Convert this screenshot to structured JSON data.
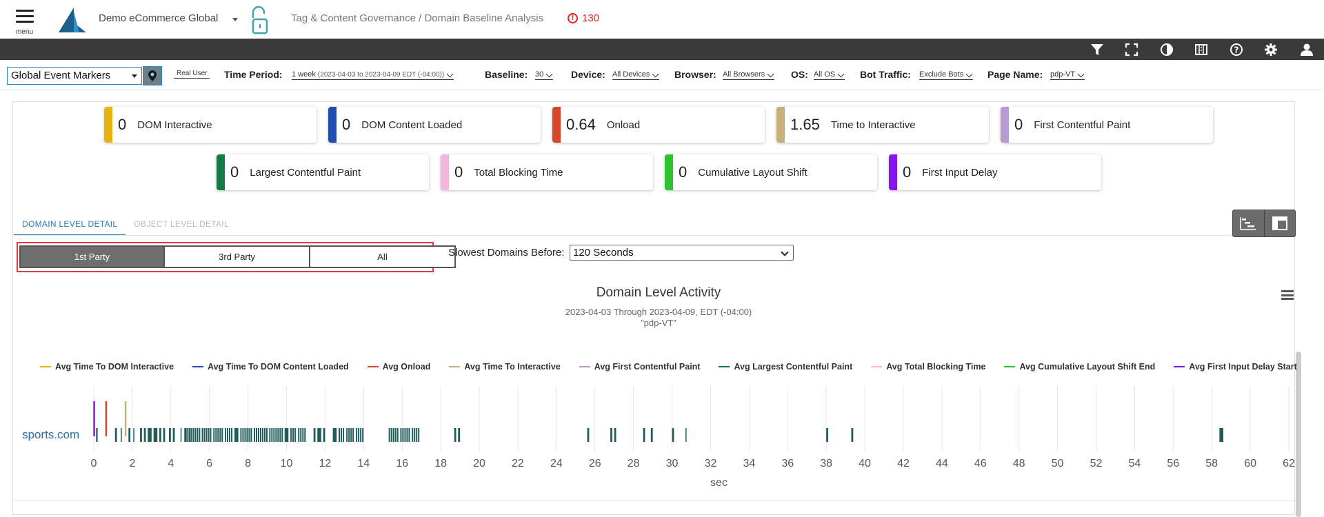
{
  "header": {
    "menu_label": "menu",
    "app_title": "Demo eCommerce Global",
    "breadcrumb": "Tag & Content Governance / Domain Baseline Analysis",
    "alert_count": "130"
  },
  "toolbar_icons": [
    "filter-icon",
    "fullscreen-icon",
    "contrast-icon",
    "columns-icon",
    "help-icon",
    "gear-icon",
    "user-icon"
  ],
  "filters": {
    "event_markers": "Global Event Markers",
    "rum_mode": "Real User",
    "time_period_label": "Time Period:",
    "time_period_value": "1 week",
    "time_period_range": "(2023-04-03 to 2023-04-09 EDT (-04:00))",
    "baseline_label": "Baseline:",
    "baseline_value": "30",
    "device_label": "Device:",
    "device_value": "All Devices",
    "browser_label": "Browser:",
    "browser_value": "All Browsers",
    "os_label": "OS:",
    "os_value": "All OS",
    "bot_label": "Bot Traffic:",
    "bot_value": "Exclude Bots",
    "page_label": "Page Name:",
    "page_value": "pdp-VT"
  },
  "metrics": [
    {
      "value": "0",
      "name": "DOM Interactive",
      "color": "#e8b40a"
    },
    {
      "value": "0",
      "name": "DOM Content Loaded",
      "color": "#1f4fb0"
    },
    {
      "value": "0.64",
      "name": "Onload",
      "color": "#d9442b"
    },
    {
      "value": "1.65",
      "name": "Time to Interactive",
      "color": "#c8b07a"
    },
    {
      "value": "0",
      "name": "First Contentful Paint",
      "color": "#b89bd0"
    },
    {
      "value": "0",
      "name": "Largest Contentful Paint",
      "color": "#137a4a"
    },
    {
      "value": "0",
      "name": "Total Blocking Time",
      "color": "#f5b5dc"
    },
    {
      "value": "0",
      "name": "Cumulative Layout Shift",
      "color": "#2ec22e"
    },
    {
      "value": "0",
      "name": "First Input Delay",
      "color": "#8a14f0"
    }
  ],
  "tabs": {
    "domain": "DOMAIN LEVEL DETAIL",
    "object": "OBJECT LEVEL DETAIL"
  },
  "party": {
    "first": "1st Party",
    "third": "3rd Party",
    "all": "All"
  },
  "slowest": {
    "label": "Slowest Domains Before:",
    "value": "120 Seconds"
  },
  "chart_data": {
    "type": "timeline",
    "title": "Domain Level Activity",
    "subtitle": "2023-04-03 Through 2023-04-09, EDT (-04:00)",
    "subtitle2": "\"pdp-VT\"",
    "xlabel": "sec",
    "xlim": [
      0,
      62
    ],
    "xticks": [
      0,
      2,
      4,
      6,
      8,
      10,
      12,
      14,
      16,
      18,
      20,
      22,
      24,
      26,
      28,
      30,
      32,
      34,
      36,
      38,
      40,
      42,
      44,
      46,
      48,
      50,
      52,
      54,
      56,
      58,
      60,
      62
    ],
    "categories": [
      "sports.com"
    ],
    "legend": [
      {
        "name": "Avg Time To DOM Interactive",
        "color": "#e8b40a"
      },
      {
        "name": "Avg Time To DOM Content Loaded",
        "color": "#1f4fb0"
      },
      {
        "name": "Avg Onload",
        "color": "#d9442b"
      },
      {
        "name": "Avg Time To Interactive",
        "color": "#c8b07a"
      },
      {
        "name": "Avg First Contentful Paint",
        "color": "#b89bd0"
      },
      {
        "name": "Avg Largest Contentful Paint",
        "color": "#137a4a"
      },
      {
        "name": "Avg Total Blocking Time",
        "color": "#f5b5dc"
      },
      {
        "name": "Avg Cumulative Layout Shift End",
        "color": "#2ec22e"
      },
      {
        "name": "Avg First Input Delay Start",
        "color": "#8a14f0"
      }
    ],
    "markers": [
      {
        "name": "Avg First Input Delay Start",
        "x": 0.02,
        "color": "#8a14f0"
      },
      {
        "name": "Avg Onload",
        "x": 0.64,
        "color": "#d9442b"
      },
      {
        "name": "Avg Time To Interactive",
        "x": 1.65,
        "color": "#c8b07a"
      }
    ],
    "activity_color": "#1f5c5c",
    "activity": [
      [
        0.12,
        0.2
      ],
      [
        1.1,
        1.2
      ],
      [
        1.4,
        1.45
      ],
      [
        1.8,
        1.9
      ],
      [
        2.05,
        2.1
      ],
      [
        2.4,
        2.5
      ],
      [
        2.6,
        2.7
      ],
      [
        2.8,
        3.0
      ],
      [
        3.1,
        3.3
      ],
      [
        3.4,
        3.5
      ],
      [
        3.6,
        3.7
      ],
      [
        3.9,
        4.0
      ],
      [
        4.1,
        4.2
      ],
      [
        4.5,
        4.55
      ],
      [
        4.7,
        4.8
      ],
      [
        4.95,
        5.0
      ],
      [
        4.7,
        5.5
      ],
      [
        5.6,
        6.1
      ],
      [
        6.2,
        6.7
      ],
      [
        6.8,
        7.2
      ],
      [
        7.3,
        7.5
      ],
      [
        7.6,
        8.2
      ],
      [
        8.3,
        9.0
      ],
      [
        9.1,
        9.8
      ],
      [
        9.9,
        10.1
      ],
      [
        10.2,
        10.5
      ],
      [
        10.6,
        11.0
      ],
      [
        11.4,
        11.5
      ],
      [
        11.6,
        11.8
      ],
      [
        11.9,
        12.0
      ],
      [
        12.4,
        12.6
      ],
      [
        12.7,
        13.0
      ],
      [
        13.1,
        13.5
      ],
      [
        13.6,
        14.0
      ],
      [
        15.3,
        15.8
      ],
      [
        15.9,
        16.4
      ],
      [
        16.5,
        16.9
      ],
      [
        18.7,
        18.8
      ],
      [
        18.9,
        19.0
      ],
      [
        25.6,
        25.7
      ],
      [
        26.8,
        26.9
      ],
      [
        27.0,
        27.1
      ],
      [
        28.5,
        28.6
      ],
      [
        28.9,
        29.0
      ],
      [
        30.0,
        30.1
      ],
      [
        30.7,
        30.75
      ],
      [
        38.0,
        38.1
      ],
      [
        39.3,
        39.4
      ],
      [
        58.4,
        58.6
      ]
    ]
  }
}
